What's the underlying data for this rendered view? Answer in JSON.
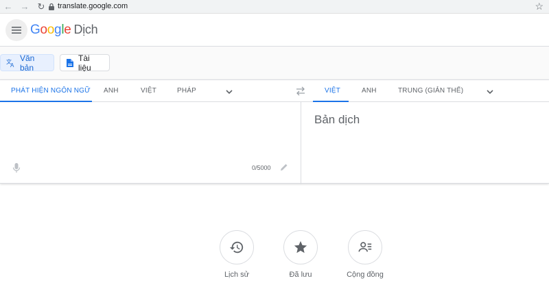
{
  "browser": {
    "url": "translate.google.com"
  },
  "app": {
    "logo_letters": [
      "G",
      "o",
      "o",
      "g",
      "l",
      "e"
    ],
    "product": "Dịch"
  },
  "modes": [
    {
      "label": "Văn bản",
      "icon": "translate-icon",
      "active": true
    },
    {
      "label": "Tài liệu",
      "icon": "document-icon",
      "active": false
    }
  ],
  "source_languages": [
    "Phát hiện ngôn ngữ",
    "Anh",
    "Việt",
    "Pháp"
  ],
  "target_languages": [
    "Việt",
    "Anh",
    "Trung (Giản thể)"
  ],
  "source": {
    "char_count": "0/5000"
  },
  "target": {
    "placeholder": "Bản dịch"
  },
  "shortcuts": [
    {
      "label": "Lịch sử",
      "icon": "history-icon"
    },
    {
      "label": "Đã lưu",
      "icon": "star-icon"
    },
    {
      "label": "Cộng đồng",
      "icon": "community-icon"
    }
  ],
  "colors": {
    "accent": "#1a73e8",
    "active_mode_bg": "#e8f0fe"
  }
}
